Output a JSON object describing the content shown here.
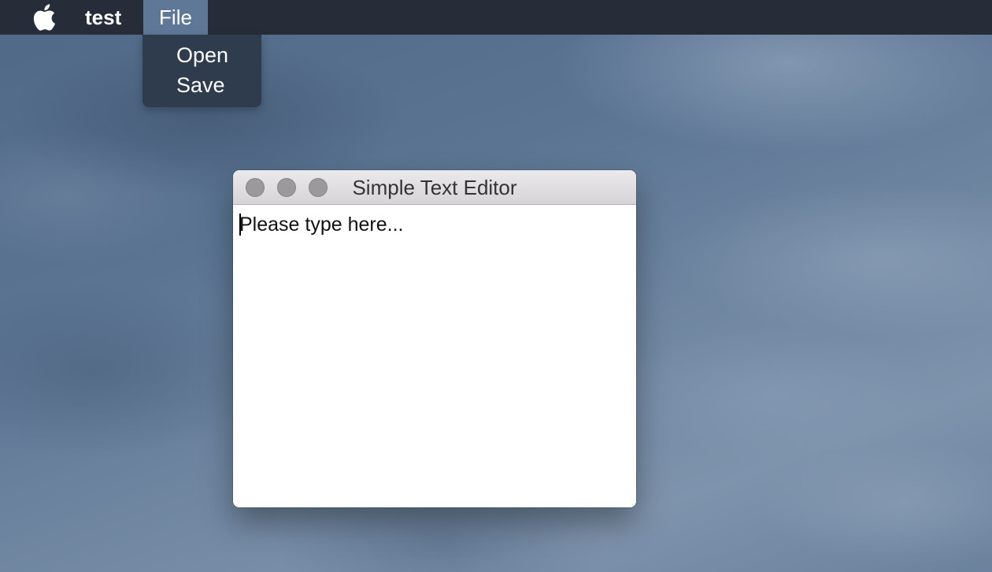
{
  "menubar": {
    "apple_icon": "apple-logo-icon",
    "app_name": "test",
    "menus": [
      {
        "label": "File",
        "selected": true
      }
    ]
  },
  "file_menu": {
    "items": [
      {
        "label": "Open"
      },
      {
        "label": "Save"
      }
    ]
  },
  "window": {
    "title": "Simple Text Editor",
    "buttons": [
      "close-button",
      "minimize-button",
      "zoom-button"
    ],
    "editor": {
      "text": "Please type here..."
    }
  },
  "colors": {
    "menubar_bg": "#262d38",
    "menu_highlight": "#5f7898",
    "dropdown_bg": "#2d3a4c",
    "traffic_light": "#9b999b"
  }
}
